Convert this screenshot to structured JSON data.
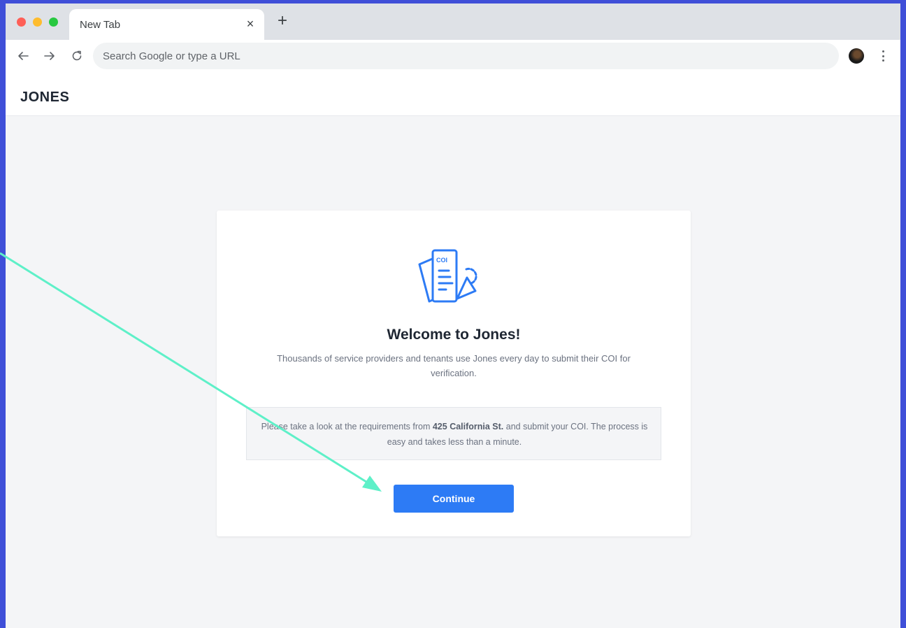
{
  "browser": {
    "tab_title": "New Tab",
    "tab_close": "×",
    "new_tab": "+",
    "omnibox_placeholder": "Search Google or type a URL"
  },
  "app": {
    "logo": "JONES"
  },
  "card": {
    "title": "Welcome to Jones!",
    "subtitle": "Thousands of service providers and tenants use Jones every day to submit their COI for verification.",
    "info_before": "Please take a look at the requirements from ",
    "info_bold": "425 California St.",
    "info_after": " and submit your COI. The process is easy and takes less than a minute.",
    "illustration_label": "COI",
    "continue_label": "Continue"
  },
  "colors": {
    "frame_bg": "#3f4fd8",
    "accent": "#2d7bf5",
    "annotation_arrow": "#5ef0c8",
    "page_bg": "#f4f5f7"
  }
}
